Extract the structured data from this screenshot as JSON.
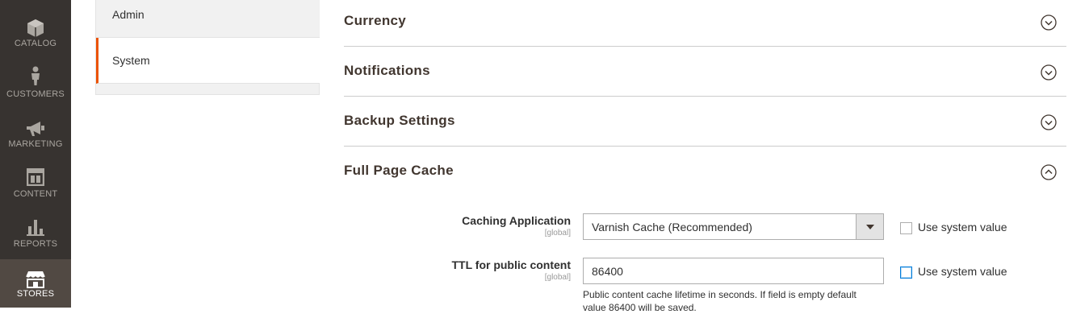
{
  "sidebar": {
    "items": [
      {
        "label": "CATALOG",
        "icon": "cube-icon"
      },
      {
        "label": "CUSTOMERS",
        "icon": "person-icon"
      },
      {
        "label": "MARKETING",
        "icon": "megaphone-icon"
      },
      {
        "label": "CONTENT",
        "icon": "layout-icon"
      },
      {
        "label": "REPORTS",
        "icon": "bar-chart-icon"
      },
      {
        "label": "STORES",
        "icon": "storefront-icon"
      }
    ],
    "active": "STORES"
  },
  "tabs": {
    "items": [
      {
        "label": "Admin"
      },
      {
        "label": "System"
      }
    ],
    "active": "System",
    "accent_color": "#eb5202"
  },
  "sections": [
    {
      "title": "Currency",
      "state": "collapsed"
    },
    {
      "title": "Notifications",
      "state": "collapsed"
    },
    {
      "title": "Backup Settings",
      "state": "collapsed"
    },
    {
      "title": "Full Page Cache",
      "state": "expanded"
    }
  ],
  "full_page_cache": {
    "caching_application": {
      "label": "Caching Application",
      "scope": "[global]",
      "value": "Varnish Cache (Recommended)",
      "use_system_value_label": "Use system value",
      "use_system_value_checked": false
    },
    "ttl": {
      "label": "TTL for public content",
      "scope": "[global]",
      "value": "86400",
      "use_system_value_label": "Use system value",
      "use_system_value_checked": false,
      "note": "Public content cache lifetime in seconds. If field is empty default value 86400 will be saved."
    }
  }
}
